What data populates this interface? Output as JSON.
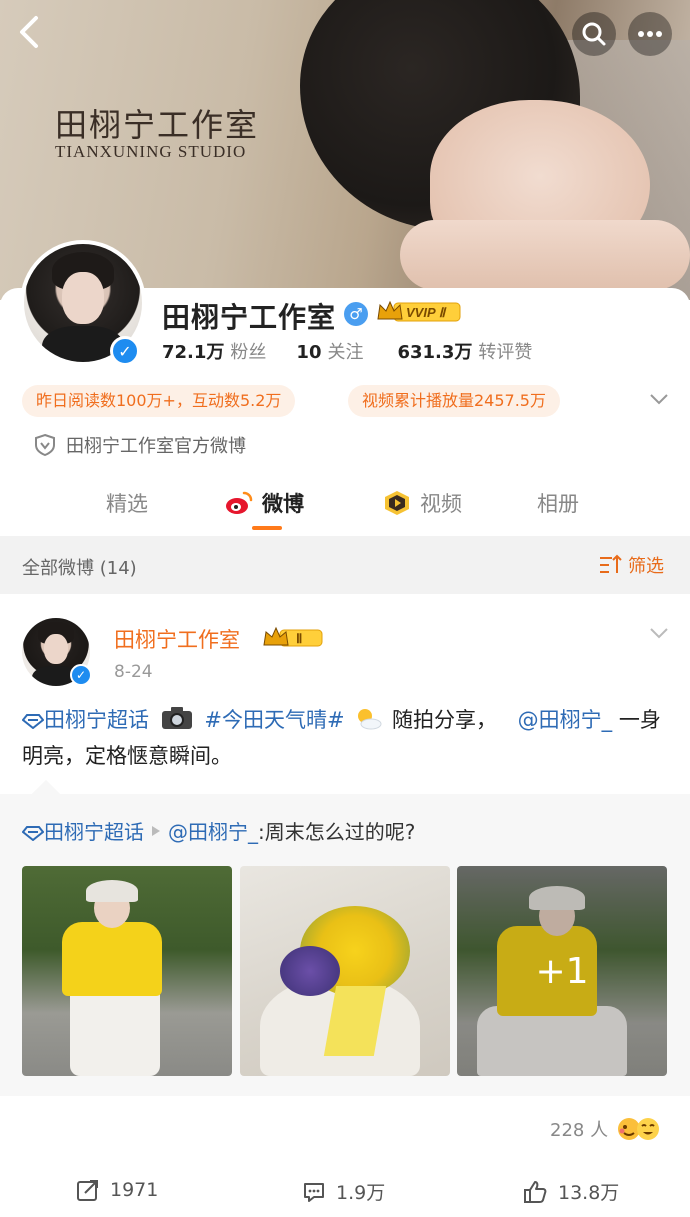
{
  "banner": {
    "studio_name_cn": "田栩宁工作室",
    "studio_name_en": "TIANXUNING STUDIO"
  },
  "profile": {
    "name": "田栩宁工作室",
    "gender_symbol": "♂",
    "vip_label": "VVIP Ⅱ",
    "followers": "72.1万",
    "followers_label": "粉丝",
    "following": "10",
    "following_label": "关注",
    "reposts_likes": "631.3万",
    "reposts_likes_label": "转评赞",
    "tag_reads": "昨日阅读数100万+，互动数5.2万",
    "tag_views": "视频累计播放量2457.5万",
    "verification": "田栩宁工作室官方微博"
  },
  "tabs": [
    {
      "label": "精选"
    },
    {
      "label": "微博"
    },
    {
      "label": "视频"
    },
    {
      "label": "相册"
    }
  ],
  "filter": {
    "all_label": "全部微博 (14)",
    "filter_label": "筛选"
  },
  "post": {
    "author": "田栩宁工作室",
    "crown_label": "Ⅱ",
    "date": "8-24",
    "supertopic": "田栩宁超话",
    "hashtag": "#今田天气晴#",
    "text_after_tag": "随拍分享，",
    "mention": "@田栩宁_",
    "text_end": "一身明亮，定格惬意瞬间。",
    "repost_supertopic": "田栩宁超话",
    "repost_mention": "@田栩宁_",
    "repost_text": ":周末怎么过的呢?",
    "image_overflow": "+1",
    "likers_count": "228 人",
    "share_count": "1971",
    "comment_count": "1.9万",
    "like_count": "13.8万"
  },
  "colors": {
    "accent_orange": "#f06e1e",
    "link_blue": "#2e6bb5",
    "verified_blue": "#1e8cf0"
  }
}
